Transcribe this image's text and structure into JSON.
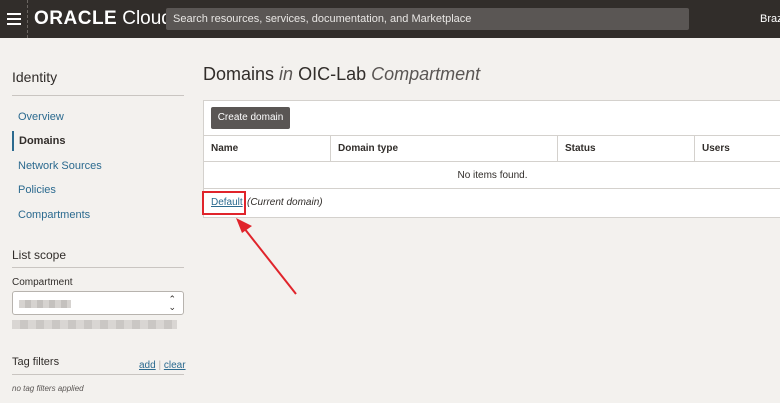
{
  "topbar": {
    "logo_brand": "ORACLE",
    "logo_product": "Cloud",
    "search_placeholder": "Search resources, services, documentation, and Marketplace",
    "region": "Brazil"
  },
  "sidebar": {
    "title": "Identity",
    "items": [
      {
        "label": "Overview",
        "active": false
      },
      {
        "label": "Domains",
        "active": true
      },
      {
        "label": "Network Sources",
        "active": false
      },
      {
        "label": "Policies",
        "active": false
      },
      {
        "label": "Compartments",
        "active": false
      }
    ],
    "list_scope": {
      "title": "List scope",
      "compartment_label": "Compartment"
    },
    "tag_filters": {
      "title": "Tag filters",
      "add_label": "add",
      "separator": "|",
      "clear_label": "clear",
      "note": "no tag filters applied"
    }
  },
  "main": {
    "heading": {
      "part1": "Domains",
      "part2": "in",
      "part3": "OIC-Lab",
      "part4": "Compartment"
    },
    "create_button": "Create domain",
    "table": {
      "columns": [
        "Name",
        "Domain type",
        "Status",
        "Users"
      ],
      "empty_message": "No items found."
    },
    "default_link": "Default",
    "current_domain": "(Current domain)"
  },
  "colors": {
    "topbar": "#312d2a",
    "link": "#2b6a8f",
    "highlight": "#e0242b"
  }
}
